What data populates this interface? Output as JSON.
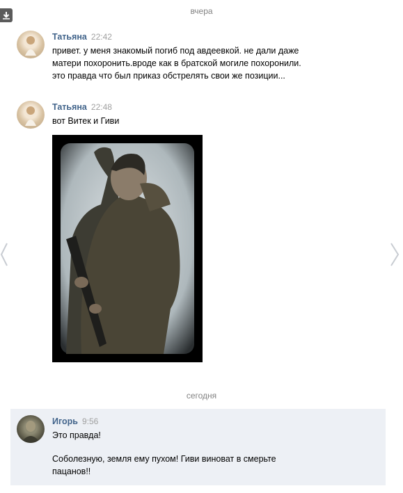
{
  "dates": {
    "yesterday": "вчера",
    "today": "сегодня"
  },
  "messages": [
    {
      "author": "Татьяна",
      "time": "22:42",
      "lines": [
        "привет. у меня знакомый погиб под авдеевкой. не дали даже",
        "матери похоронить.вроде как в братской могиле похоронили.",
        "это правда что был приказ обстрелять свои же позиции..."
      ]
    },
    {
      "author": "Татьяна",
      "time": "22:48",
      "lines": [
        "вот Витек и Гиви"
      ],
      "attachment": "photo"
    },
    {
      "author": "Игорь",
      "time": "9:56",
      "lines": [
        "Это правда!"
      ],
      "lines2": [
        "Соболезную, земля ему пухом! Гиви виноват в смерьте",
        "пацанов!!"
      ]
    }
  ],
  "colors": {
    "author": "#42648b",
    "time": "#a0a0a0",
    "date": "#828282",
    "highlight": "#edf0f5"
  }
}
